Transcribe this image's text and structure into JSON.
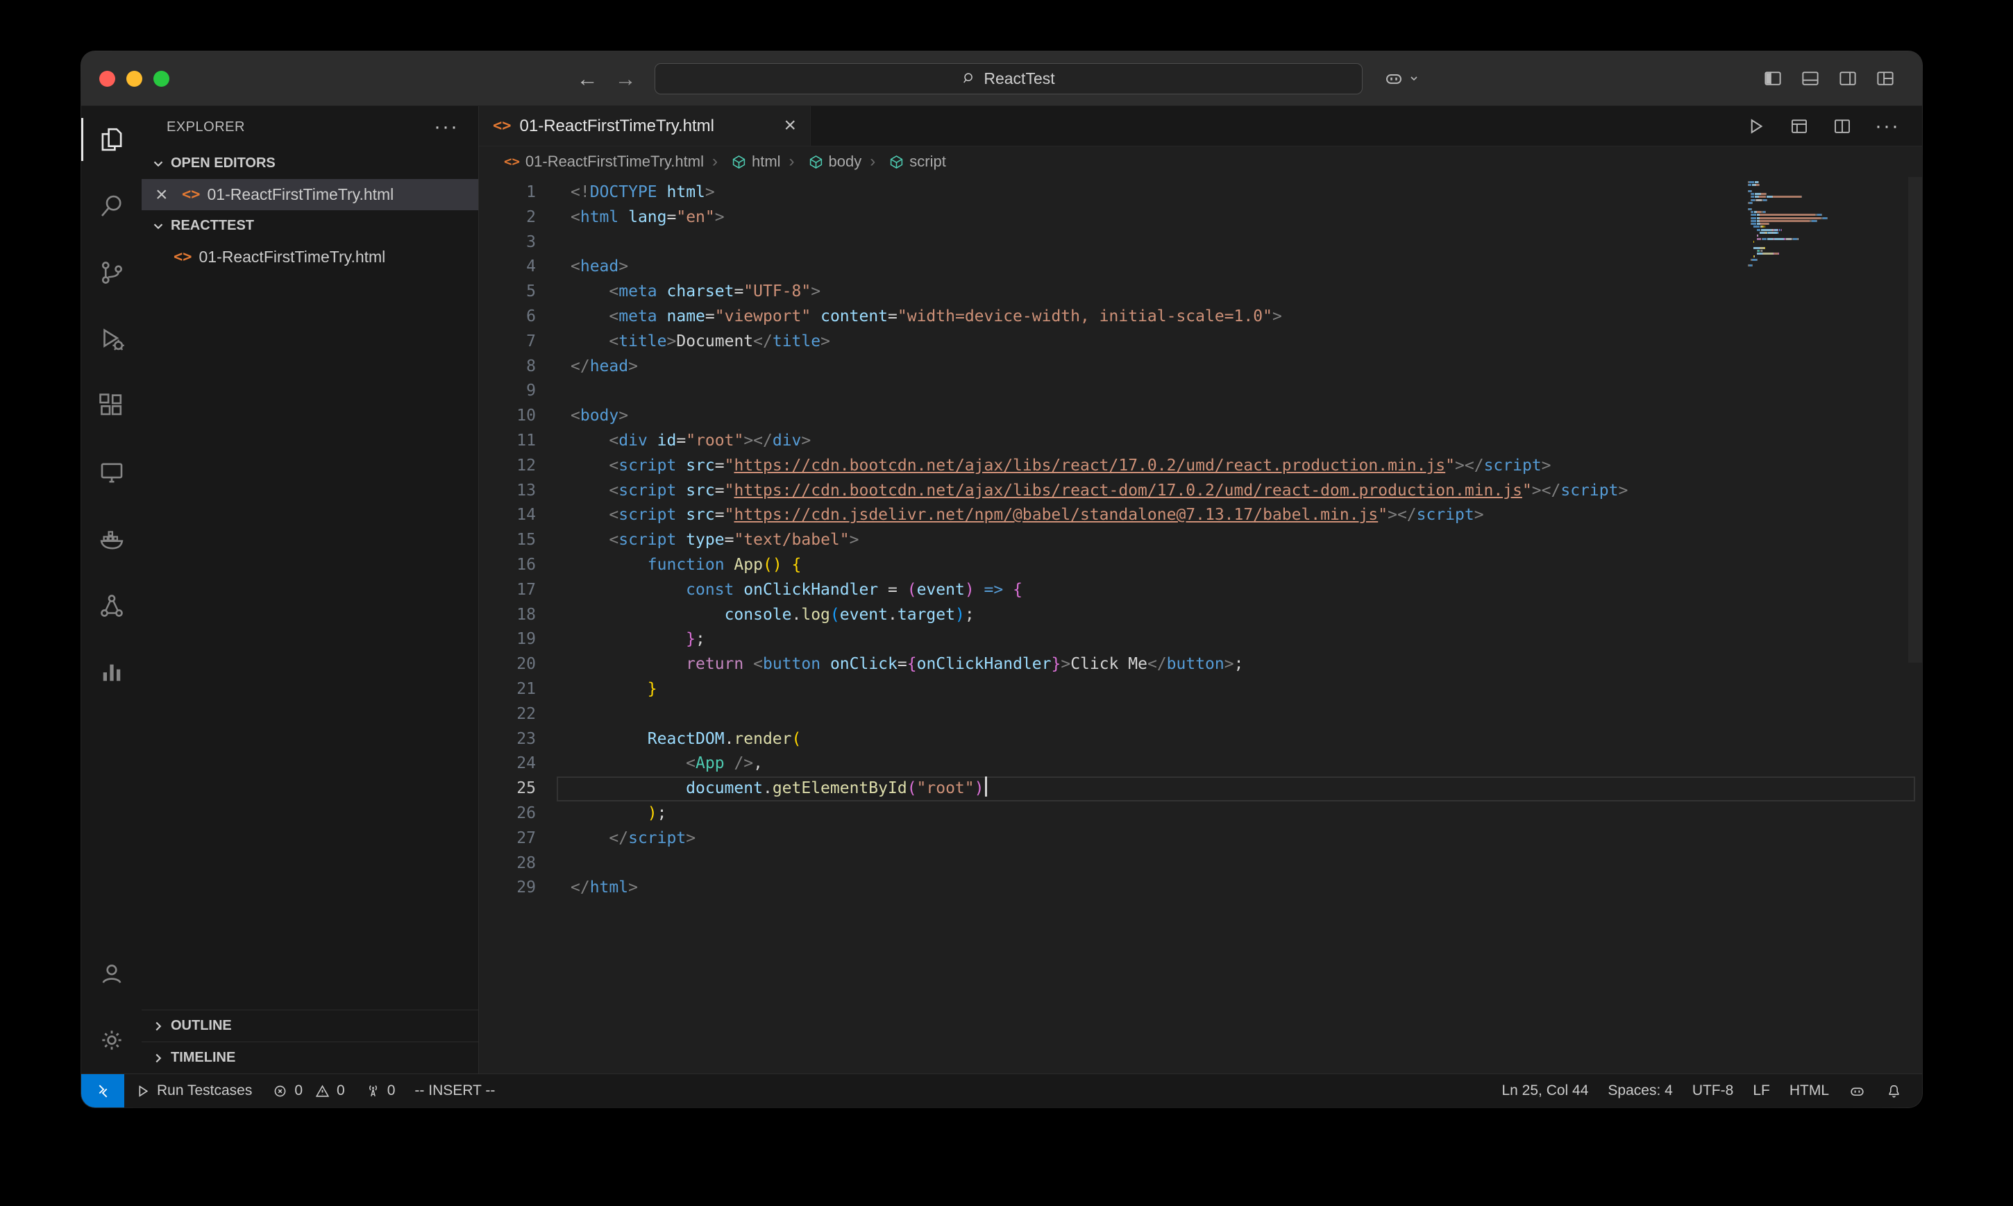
{
  "titlebar": {
    "command_center": "ReactTest",
    "nav_icons": [
      "back-arrow",
      "forward-arrow"
    ],
    "right_icons": [
      "copilot-menu",
      "toggle-primary-sidebar",
      "toggle-panel",
      "toggle-secondary-sidebar",
      "customize-layout"
    ]
  },
  "activity_bar": {
    "items": [
      "explorer",
      "search",
      "source-control",
      "run-and-debug",
      "extensions",
      "remote-explorer",
      "docker",
      "references",
      "charts"
    ],
    "active": "explorer",
    "bottom": [
      "account",
      "settings"
    ]
  },
  "sidebar": {
    "title": "EXPLORER",
    "open_editors": {
      "label": "OPEN EDITORS",
      "items": [
        {
          "name": "01-ReactFirstTimeTry.html",
          "selected": true
        }
      ]
    },
    "workspace": {
      "label": "REACTTEST",
      "files": [
        {
          "name": "01-ReactFirstTimeTry.html"
        }
      ]
    },
    "outline_label": "OUTLINE",
    "timeline_label": "TIMELINE"
  },
  "editor": {
    "tab": {
      "label": "01-ReactFirstTimeTry.html"
    },
    "toolbar_icons": [
      "run",
      "open-preview",
      "split-editor",
      "more-actions"
    ],
    "breadcrumbs": [
      {
        "label": "01-ReactFirstTimeTry.html",
        "icon": "html-file"
      },
      {
        "label": "html",
        "icon": "symbol-cube"
      },
      {
        "label": "body",
        "icon": "symbol-cube"
      },
      {
        "label": "script",
        "icon": "symbol-cube"
      }
    ]
  },
  "code": {
    "cursor_line": 25,
    "lines": [
      [
        [
          "p",
          "<!"
        ],
        [
          "tag",
          "DOCTYPE"
        ],
        [
          "d",
          " "
        ],
        [
          "attr",
          "html"
        ],
        [
          "p",
          ">"
        ]
      ],
      [
        [
          "p",
          "<"
        ],
        [
          "tag",
          "html"
        ],
        [
          "d",
          " "
        ],
        [
          "attr",
          "lang"
        ],
        [
          "d",
          "="
        ],
        [
          "str",
          "\"en\""
        ],
        [
          "p",
          ">"
        ]
      ],
      [],
      [
        [
          "p",
          "<"
        ],
        [
          "tag",
          "head"
        ],
        [
          "p",
          ">"
        ]
      ],
      [
        [
          "d",
          "    "
        ],
        [
          "p",
          "<"
        ],
        [
          "tag",
          "meta"
        ],
        [
          "d",
          " "
        ],
        [
          "attr",
          "charset"
        ],
        [
          "d",
          "="
        ],
        [
          "str",
          "\"UTF-8\""
        ],
        [
          "p",
          ">"
        ]
      ],
      [
        [
          "d",
          "    "
        ],
        [
          "p",
          "<"
        ],
        [
          "tag",
          "meta"
        ],
        [
          "d",
          " "
        ],
        [
          "attr",
          "name"
        ],
        [
          "d",
          "="
        ],
        [
          "str",
          "\"viewport\""
        ],
        [
          "d",
          " "
        ],
        [
          "attr",
          "content"
        ],
        [
          "d",
          "="
        ],
        [
          "str",
          "\"width=device-width, initial-scale=1.0\""
        ],
        [
          "p",
          ">"
        ]
      ],
      [
        [
          "d",
          "    "
        ],
        [
          "p",
          "<"
        ],
        [
          "tag",
          "title"
        ],
        [
          "p",
          ">"
        ],
        [
          "d",
          "Document"
        ],
        [
          "p",
          "</"
        ],
        [
          "tag",
          "title"
        ],
        [
          "p",
          ">"
        ]
      ],
      [
        [
          "p",
          "</"
        ],
        [
          "tag",
          "head"
        ],
        [
          "p",
          ">"
        ]
      ],
      [],
      [
        [
          "p",
          "<"
        ],
        [
          "tag",
          "body"
        ],
        [
          "p",
          ">"
        ]
      ],
      [
        [
          "d",
          "    "
        ],
        [
          "p",
          "<"
        ],
        [
          "tag",
          "div"
        ],
        [
          "d",
          " "
        ],
        [
          "attr",
          "id"
        ],
        [
          "d",
          "="
        ],
        [
          "str",
          "\"root\""
        ],
        [
          "p",
          "></"
        ],
        [
          "tag",
          "div"
        ],
        [
          "p",
          ">"
        ]
      ],
      [
        [
          "d",
          "    "
        ],
        [
          "p",
          "<"
        ],
        [
          "tag",
          "script"
        ],
        [
          "d",
          " "
        ],
        [
          "attr",
          "src"
        ],
        [
          "d",
          "="
        ],
        [
          "str",
          "\""
        ],
        [
          "link",
          "https://cdn.bootcdn.net/ajax/libs/react/17.0.2/umd/react.production.min.js"
        ],
        [
          "str",
          "\""
        ],
        [
          "p",
          "></"
        ],
        [
          "tag",
          "script"
        ],
        [
          "p",
          ">"
        ]
      ],
      [
        [
          "d",
          "    "
        ],
        [
          "p",
          "<"
        ],
        [
          "tag",
          "script"
        ],
        [
          "d",
          " "
        ],
        [
          "attr",
          "src"
        ],
        [
          "d",
          "="
        ],
        [
          "str",
          "\""
        ],
        [
          "link",
          "https://cdn.bootcdn.net/ajax/libs/react-dom/17.0.2/umd/react-dom.production.min.js"
        ],
        [
          "str",
          "\""
        ],
        [
          "p",
          "></"
        ],
        [
          "tag",
          "script"
        ],
        [
          "p",
          ">"
        ]
      ],
      [
        [
          "d",
          "    "
        ],
        [
          "p",
          "<"
        ],
        [
          "tag",
          "script"
        ],
        [
          "d",
          " "
        ],
        [
          "attr",
          "src"
        ],
        [
          "d",
          "="
        ],
        [
          "str",
          "\""
        ],
        [
          "link",
          "https://cdn.jsdelivr.net/npm/@babel/standalone@7.13.17/babel.min.js"
        ],
        [
          "str",
          "\""
        ],
        [
          "p",
          "></"
        ],
        [
          "tag",
          "script"
        ],
        [
          "p",
          ">"
        ]
      ],
      [
        [
          "d",
          "    "
        ],
        [
          "p",
          "<"
        ],
        [
          "tag",
          "script"
        ],
        [
          "d",
          " "
        ],
        [
          "attr",
          "type"
        ],
        [
          "d",
          "="
        ],
        [
          "str",
          "\"text/babel\""
        ],
        [
          "p",
          ">"
        ]
      ],
      [
        [
          "d",
          "        "
        ],
        [
          "tag",
          "function"
        ],
        [
          "d",
          " "
        ],
        [
          "fn",
          "App"
        ],
        [
          "b1",
          "()"
        ],
        [
          "d",
          " "
        ],
        [
          "b1",
          "{"
        ]
      ],
      [
        [
          "d",
          "            "
        ],
        [
          "tag",
          "const"
        ],
        [
          "d",
          " "
        ],
        [
          "attr",
          "onClickHandler"
        ],
        [
          "d",
          " = "
        ],
        [
          "b2",
          "("
        ],
        [
          "attr",
          "event"
        ],
        [
          "b2",
          ")"
        ],
        [
          "d",
          " "
        ],
        [
          "tag",
          "=>"
        ],
        [
          "d",
          " "
        ],
        [
          "b2",
          "{"
        ]
      ],
      [
        [
          "d",
          "                "
        ],
        [
          "attr",
          "console"
        ],
        [
          "d",
          "."
        ],
        [
          "fn",
          "log"
        ],
        [
          "b3",
          "("
        ],
        [
          "attr",
          "event"
        ],
        [
          "d",
          "."
        ],
        [
          "attr",
          "target"
        ],
        [
          "b3",
          ")"
        ],
        [
          "d",
          ";"
        ]
      ],
      [
        [
          "d",
          "            "
        ],
        [
          "b2",
          "}"
        ],
        [
          "d",
          ";"
        ]
      ],
      [
        [
          "d",
          "            "
        ],
        [
          "kw2",
          "return"
        ],
        [
          "d",
          " "
        ],
        [
          "p",
          "<"
        ],
        [
          "tag",
          "button"
        ],
        [
          "d",
          " "
        ],
        [
          "attr",
          "onClick"
        ],
        [
          "d",
          "="
        ],
        [
          "b2",
          "{"
        ],
        [
          "attr",
          "onClickHandler"
        ],
        [
          "b2",
          "}"
        ],
        [
          "p",
          ">"
        ],
        [
          "d",
          "Click Me"
        ],
        [
          "p",
          "</"
        ],
        [
          "tag",
          "button"
        ],
        [
          "p",
          ">"
        ],
        [
          "d",
          ";"
        ]
      ],
      [
        [
          "d",
          "        "
        ],
        [
          "b1",
          "}"
        ]
      ],
      [],
      [
        [
          "d",
          "        "
        ],
        [
          "attr",
          "ReactDOM"
        ],
        [
          "d",
          "."
        ],
        [
          "fn",
          "render"
        ],
        [
          "b1",
          "("
        ]
      ],
      [
        [
          "d",
          "            "
        ],
        [
          "p",
          "<"
        ],
        [
          "cls",
          "App"
        ],
        [
          "d",
          " "
        ],
        [
          "p",
          "/>"
        ],
        [
          "d",
          ","
        ]
      ],
      [
        [
          "d",
          "            "
        ],
        [
          "attr",
          "document"
        ],
        [
          "d",
          "."
        ],
        [
          "fn",
          "getElementById"
        ],
        [
          "b2",
          "("
        ],
        [
          "str",
          "\"root\""
        ],
        [
          "b2",
          ")"
        ]
      ],
      [
        [
          "d",
          "        "
        ],
        [
          "b1",
          ")"
        ],
        [
          "d",
          ";"
        ]
      ],
      [
        [
          "d",
          "    "
        ],
        [
          "p",
          "</"
        ],
        [
          "tag",
          "script"
        ],
        [
          "p",
          ">"
        ]
      ],
      [],
      [
        [
          "p",
          "</"
        ],
        [
          "tag",
          "html"
        ],
        [
          "p",
          ">"
        ]
      ]
    ]
  },
  "status_bar": {
    "remote_icon": "remote-indicator",
    "run_testcases": "Run Testcases",
    "errors": "0",
    "warnings": "0",
    "ports": "0",
    "mode": "-- INSERT --",
    "cursor": "Ln 25, Col 44",
    "indent": "Spaces: 4",
    "encoding": "UTF-8",
    "eol": "LF",
    "language": "HTML"
  },
  "colors": {
    "accent_blue": "#0078d4",
    "titlebar_bg": "#2d2d2d",
    "editor_bg": "#1f1f1f",
    "panel_bg": "#181818",
    "selected_row": "#37373d",
    "html_icon": "#e37933",
    "traffic_close": "#ff5f57",
    "traffic_min": "#febc2e",
    "traffic_zoom": "#28c840"
  }
}
